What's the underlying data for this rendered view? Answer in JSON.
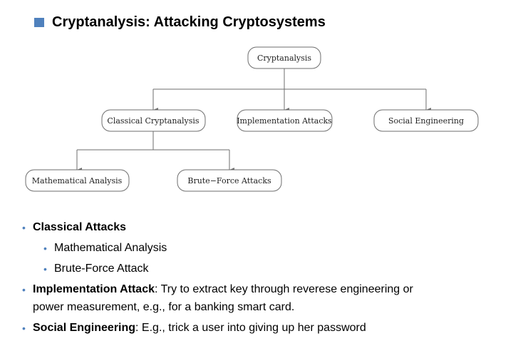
{
  "slide": {
    "title": "Cryptanalysis: Attacking Cryptosystems",
    "accent_color": "#4f81bd"
  },
  "diagram": {
    "nodes": {
      "root": "Cryptanalysis",
      "classical": "Classical Cryptanalysis",
      "implementation": "Implementation Attacks",
      "social": "Social Engineering",
      "mathematical": "Mathematical Analysis",
      "brute_force": "Brute−Force Attacks"
    }
  },
  "bullets": {
    "classical": {
      "head": "Classical Attacks"
    },
    "sub": [
      "Mathematical Analysis",
      "Brute-Force Attack"
    ],
    "implementation": {
      "head": "Implementation Attack",
      "text1": ": Try to extract key through reverese engineering or",
      "text2": "power measurement, e.g., for a banking smart card."
    },
    "social": {
      "head": "Social Engineering",
      "text": ": E.g., trick a user into giving up her password"
    },
    "bullet_glyph": "•"
  }
}
